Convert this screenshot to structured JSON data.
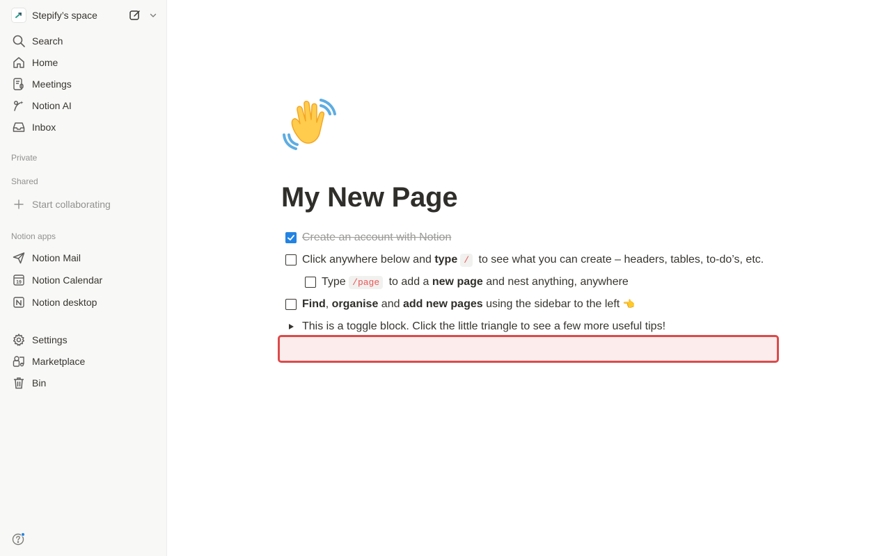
{
  "workspace": {
    "name": "Stepify’s space"
  },
  "nav": {
    "search": "Search",
    "home": "Home",
    "meetings": "Meetings",
    "notion_ai": "Notion AI",
    "inbox": "Inbox"
  },
  "sections": {
    "private": "Private",
    "shared": "Shared",
    "start_collaborating": "Start collaborating",
    "notion_apps": "Notion apps"
  },
  "apps": {
    "mail": "Notion Mail",
    "calendar": "Notion Calendar",
    "calendar_icon_number": "19",
    "desktop": "Notion desktop"
  },
  "footer_nav": {
    "settings": "Settings",
    "marketplace": "Marketplace",
    "bin": "Bin"
  },
  "page": {
    "icon_emoji": "👋",
    "title": "My New Page",
    "todo1": {
      "text": "Create an account with Notion",
      "checked": true
    },
    "todo2": {
      "part1": "Click anywhere below and ",
      "bold": "type",
      "code": "/",
      "part2": " to see what you can create – headers, tables, to-do’s, etc.",
      "checked": false
    },
    "todo3": {
      "part1": "Type ",
      "code": "/page",
      "part2": " to add a ",
      "bold": "new page",
      "part3": " and nest anything, anywhere",
      "checked": false
    },
    "todo4": {
      "bold1": "Find",
      "sep1": ", ",
      "bold2": "organise",
      "mid": " and ",
      "bold3": "add new pages",
      "part2": " using the sidebar to the left ",
      "emoji": "👈",
      "checked": false
    },
    "toggle": "This is a toggle block. Click the little triangle to see a few more useful tips!"
  },
  "colors": {
    "accent": "#2383e2",
    "sidebar_bg": "#f8f8f7",
    "highlight_border": "#dc4a4a",
    "highlight_fill": "#fdecec",
    "code_text": "#eb5757"
  }
}
